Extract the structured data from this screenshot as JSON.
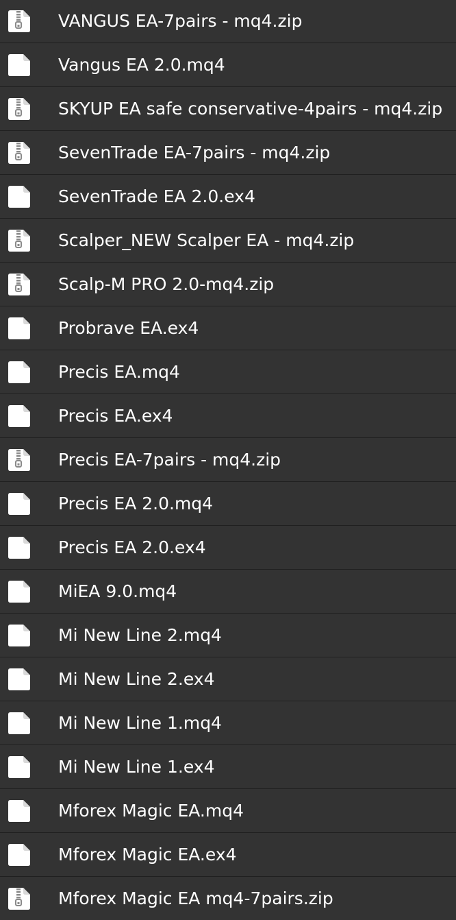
{
  "files": [
    {
      "name": "VANGUS EA-7pairs - mq4.zip",
      "icon": "zip-file-icon"
    },
    {
      "name": "Vangus EA 2.0.mq4",
      "icon": "file-icon"
    },
    {
      "name": "SKYUP EA safe conservative-4pairs - mq4.zip",
      "icon": "zip-file-icon"
    },
    {
      "name": "SevenTrade EA-7pairs - mq4.zip",
      "icon": "zip-file-icon"
    },
    {
      "name": "SevenTrade EA 2.0.ex4",
      "icon": "file-icon"
    },
    {
      "name": "Scalper_NEW Scalper EA - mq4.zip",
      "icon": "zip-file-icon"
    },
    {
      "name": "Scalp-M PRO 2.0-mq4.zip",
      "icon": "zip-file-icon"
    },
    {
      "name": "Probrave EA.ex4",
      "icon": "file-icon"
    },
    {
      "name": "Precis EA.mq4",
      "icon": "file-icon"
    },
    {
      "name": "Precis EA.ex4",
      "icon": "file-icon"
    },
    {
      "name": "Precis EA-7pairs - mq4.zip",
      "icon": "zip-file-icon"
    },
    {
      "name": "Precis EA 2.0.mq4",
      "icon": "file-icon"
    },
    {
      "name": "Precis EA 2.0.ex4",
      "icon": "file-icon"
    },
    {
      "name": "MiEA 9.0.mq4",
      "icon": "file-icon"
    },
    {
      "name": "Mi New Line 2.mq4",
      "icon": "file-icon"
    },
    {
      "name": "Mi New Line 2.ex4",
      "icon": "file-icon"
    },
    {
      "name": "Mi New Line 1.mq4",
      "icon": "file-icon"
    },
    {
      "name": "Mi New Line 1.ex4",
      "icon": "file-icon"
    },
    {
      "name": "Mforex Magic EA.mq4",
      "icon": "file-icon"
    },
    {
      "name": "Mforex Magic EA.ex4",
      "icon": "file-icon"
    },
    {
      "name": "Mforex Magic EA mq4-7pairs.zip",
      "icon": "zip-file-icon"
    }
  ],
  "colors": {
    "background": "#333333",
    "divider": "#202020",
    "text": "#ffffff",
    "icon_fill": "#ffffff",
    "zipper": "#8a8a8a"
  }
}
